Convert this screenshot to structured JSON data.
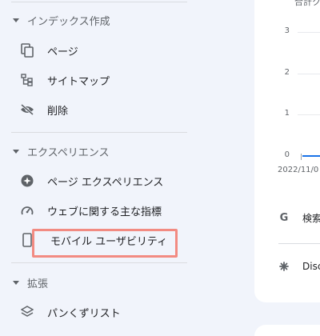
{
  "sidebar": {
    "sections": [
      {
        "label": "インデックス作成",
        "items": [
          {
            "label": "ページ",
            "icon": "pages-icon"
          },
          {
            "label": "サイトマップ",
            "icon": "sitemap-icon"
          },
          {
            "label": "削除",
            "icon": "removals-icon"
          }
        ]
      },
      {
        "label": "エクスペリエンス",
        "items": [
          {
            "label": "ページ エクスペリエンス",
            "icon": "page-experience-icon"
          },
          {
            "label": "ウェブに関する主な指標",
            "icon": "core-web-vitals-icon"
          },
          {
            "label": "モバイル ユーザビリティ",
            "icon": "mobile-icon"
          }
        ]
      },
      {
        "label": "拡張",
        "items": [
          {
            "label": "パンくずリスト",
            "icon": "breadcrumbs-icon"
          }
        ]
      }
    ]
  },
  "card": {
    "top_text": "合計ク",
    "yticks": [
      "3",
      "2",
      "1",
      "0"
    ],
    "xlabel": "2022/11/0",
    "rows": [
      {
        "label": "検索",
        "icon": "google-g-icon"
      },
      {
        "label": "Disc",
        "icon": "discover-icon"
      }
    ]
  },
  "colors": {
    "highlight": "#f28b82",
    "accent": "#1a73e8"
  }
}
